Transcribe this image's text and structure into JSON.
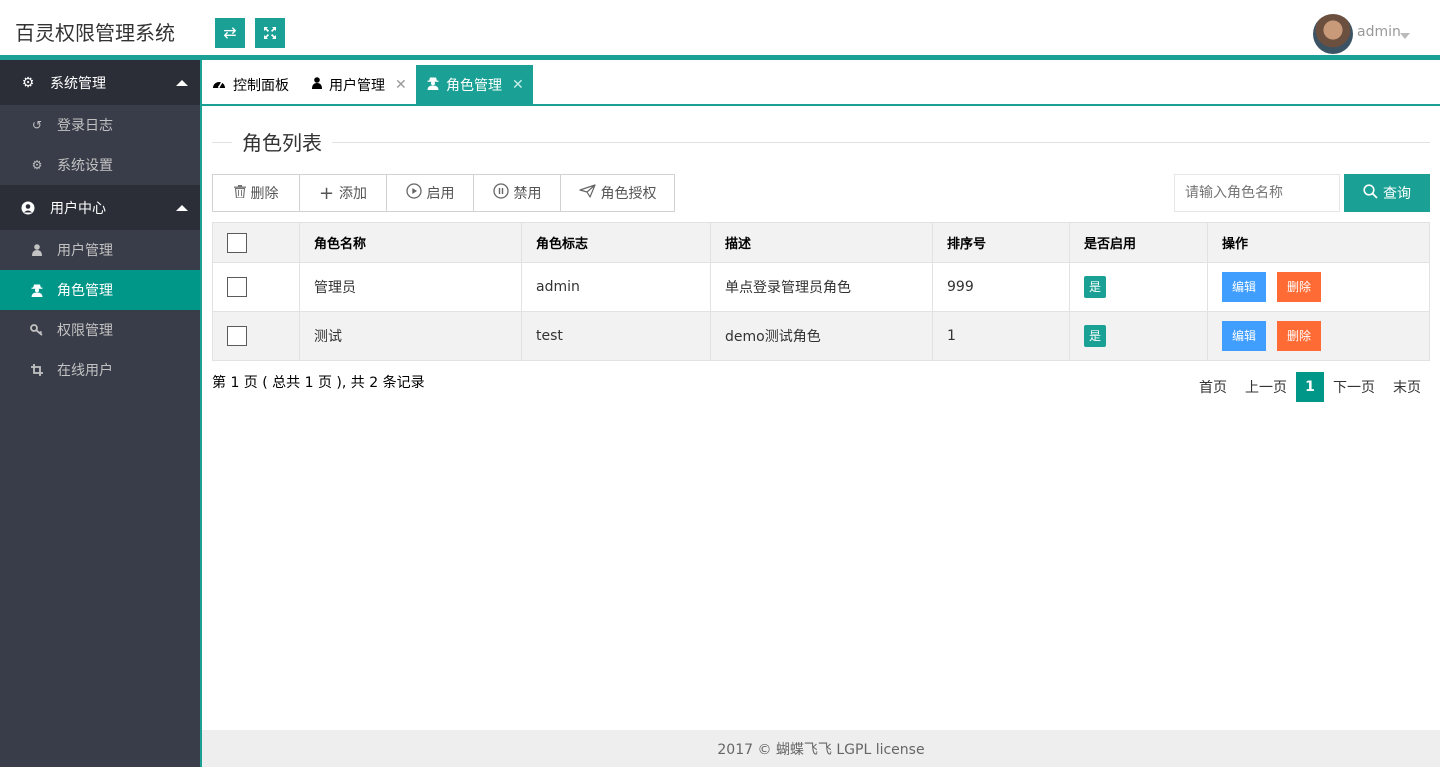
{
  "header": {
    "logo": "百灵权限管理系统",
    "switch_icon": "⇄",
    "fullscreen_icon": "⤢",
    "user": "admin"
  },
  "sidebar": {
    "groups": [
      {
        "label": "系统管理",
        "icon": "gears-icon",
        "items": [
          {
            "label": "登录日志",
            "icon": "history-icon"
          },
          {
            "label": "系统设置",
            "icon": "gear-icon"
          }
        ]
      },
      {
        "label": "用户中心",
        "icon": "user-circle-icon",
        "items": [
          {
            "label": "用户管理",
            "icon": "user-icon"
          },
          {
            "label": "角色管理",
            "icon": "user-secret-icon",
            "active": true
          },
          {
            "label": "权限管理",
            "icon": "key-icon"
          },
          {
            "label": "在线用户",
            "icon": "crop-icon"
          }
        ]
      }
    ]
  },
  "tabs": [
    {
      "label": "控制面板",
      "icon": "dashboard-icon",
      "closable": false
    },
    {
      "label": "用户管理",
      "icon": "user-icon",
      "closable": true
    },
    {
      "label": "角色管理",
      "icon": "user-secret-icon",
      "closable": true,
      "active": true
    }
  ],
  "section_title": "角色列表",
  "toolbar": {
    "delete": "删除",
    "add": "添加",
    "enable": "启用",
    "disable": "禁用",
    "authorize": "角色授权"
  },
  "search": {
    "placeholder": "请输入角色名称",
    "button": "查询"
  },
  "table": {
    "columns": [
      "角色名称",
      "角色标志",
      "描述",
      "排序号",
      "是否启用",
      "操作"
    ],
    "rows": [
      {
        "name": "管理员",
        "flag": "admin",
        "desc": "单点登录管理员角色",
        "order": "999",
        "enabled": "是",
        "edit": "编辑",
        "del": "删除"
      },
      {
        "name": "测试",
        "flag": "test",
        "desc": "demo测试角色",
        "order": "1",
        "enabled": "是",
        "edit": "编辑",
        "del": "删除"
      }
    ]
  },
  "pagination": {
    "info": "第 1 页 ( 总共 1 页 ), 共 2 条记录",
    "first": "首页",
    "prev": "上一页",
    "current": "1",
    "next": "下一页",
    "last": "末页"
  },
  "footer": "2017 © 蝴蝶飞飞 LGPL license",
  "colors": {
    "accent": "#1aa094",
    "sidebar_bg": "#393d49",
    "sidebar_group_bg": "#2b2e37",
    "active_item": "#009688",
    "edit_btn": "#409eff",
    "delete_btn": "#ff6b35"
  }
}
